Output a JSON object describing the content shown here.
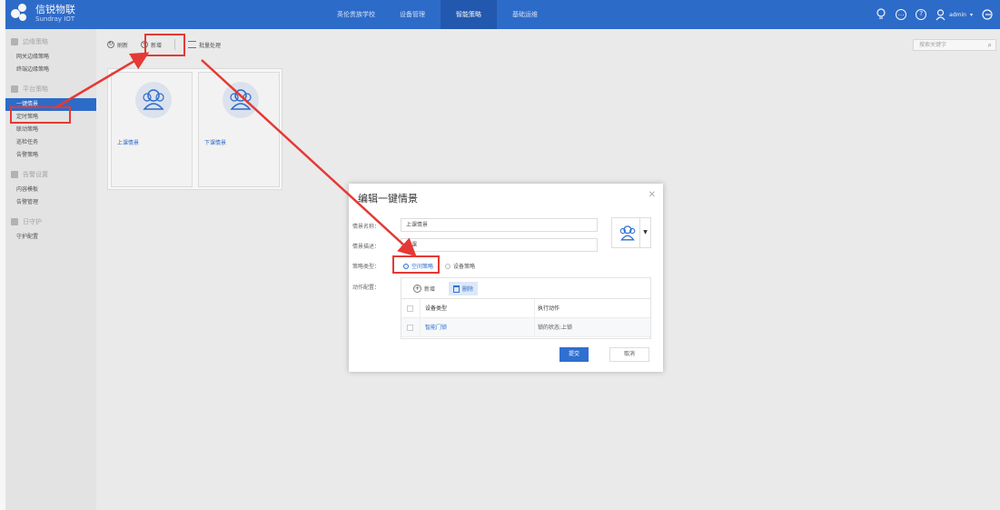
{
  "brand": {
    "name_cn": "信锐物联",
    "name_en": "Sundray IOT"
  },
  "nav": {
    "items": [
      "英伦贵族学校",
      "设备管理",
      "智能策略",
      "基础运维"
    ],
    "active": 2
  },
  "topbar": {
    "user": "admin"
  },
  "sidebar": {
    "groups": [
      {
        "label": "边缘策略",
        "items": [
          "网关边缘策略",
          "终端边缘策略"
        ]
      },
      {
        "label": "平台策略",
        "items": [
          "一键情景",
          "定时策略",
          "联动策略",
          "巡检任务",
          "告警策略"
        ]
      },
      {
        "label": "告警设置",
        "items": [
          "内容模板",
          "告警管理"
        ]
      },
      {
        "label": "日守护",
        "items": [
          "守护配置"
        ]
      }
    ],
    "active_item": "一键情景"
  },
  "toolbar": {
    "refresh": "刷新",
    "add": "新增",
    "batch": "批量处理"
  },
  "search": {
    "placeholder": "搜索关键字"
  },
  "cards": [
    {
      "name": "上课情景"
    },
    {
      "name": "下课情景"
    }
  ],
  "dialog": {
    "title": "编辑一键情景",
    "name_label": "情景名称：",
    "name_value": "上课情景",
    "desc_label": "情景描述：",
    "desc_value": "上课",
    "type_label": "策略类型：",
    "type_options": [
      "空间策略",
      "设备策略"
    ],
    "type_selected": 0,
    "action_label": "动作配置：",
    "action_add": "新增",
    "action_delete": "删除",
    "columns": [
      "设备类型",
      "执行动作"
    ],
    "rows": [
      {
        "device": "智能门锁",
        "action": "锁的状态:上锁"
      }
    ],
    "submit": "提交",
    "cancel": "取消"
  },
  "colors": {
    "primary": "#2f6fd0",
    "highlight": "#e53935"
  }
}
